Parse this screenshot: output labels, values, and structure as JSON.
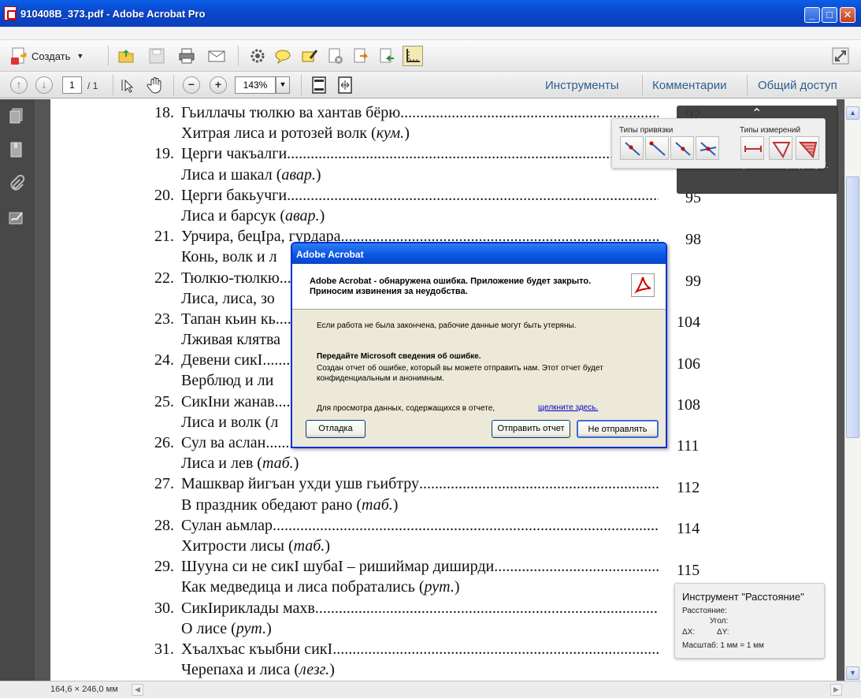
{
  "window": {
    "title": "910408B_373.pdf - Adobe Acrobat Pro",
    "minimize": "_",
    "maximize": "□",
    "close": "✕"
  },
  "toolbar": {
    "create_label": "Создать",
    "icons": [
      "open-folder-icon",
      "save-icon",
      "print-icon",
      "email-icon",
      "settings-icon",
      "comment-icon",
      "highlight-icon",
      "delete-page-icon",
      "export-icon",
      "import-icon",
      "measure-ruler-icon",
      "fullscreen-icon"
    ]
  },
  "nav": {
    "page_current": "1",
    "page_total": "/ 1",
    "zoom": "143%",
    "tabs": [
      "Инструменты",
      "Комментарии",
      "Общий доступ"
    ]
  },
  "toc": {
    "items": [
      {
        "num": "18.",
        "title": "Гьиллачы тюлкю ва хантав бёрю",
        "sub": "Хитрая лиса и ротозей волк (кум.)",
        "page": "92"
      },
      {
        "num": "19.",
        "title": "Церги чакъалги",
        "sub": "Лиса и шакал (авар.)",
        "page": ""
      },
      {
        "num": "20.",
        "title": "Церги бакьучги",
        "sub": "Лиса и барсук (авар.)",
        "page": "95"
      },
      {
        "num": "21.",
        "title": "Урчира, бецIра, гурдара",
        "sub": "Конь, волк и л",
        "page": "98"
      },
      {
        "num": "22.",
        "title": "Тюлкю-тюлкю",
        "sub": "Лиса, лиса, зо",
        "page": "99"
      },
      {
        "num": "23.",
        "title": "Тапан кьин кь",
        "sub": "Лживая клятва",
        "page": "104"
      },
      {
        "num": "24.",
        "title": "Девени сикI",
        "sub": "Верблюд и ли",
        "page": "106"
      },
      {
        "num": "25.",
        "title": "СикIни жанав",
        "sub": "Лиса и волк (л",
        "page": "108"
      },
      {
        "num": "26.",
        "title": "Сул ва аслан",
        "sub": "Лиса и лев (таб.)",
        "page": "111"
      },
      {
        "num": "27.",
        "title": "Машквар йигъан ухди ушв гьибтру",
        "sub": "В праздник обедают рано (таб.)",
        "page": "112"
      },
      {
        "num": "28.",
        "title": "Сулан аьмлар",
        "sub": "Хитрости лисы (таб.)",
        "page": "114"
      },
      {
        "num": "29.",
        "title": "Шууна си не сикI шубаI – ришиймар диширди",
        "sub": "Как медведица и лиса побратались (рут.)",
        "page": "115"
      },
      {
        "num": "30.",
        "title": "СикIириклады махв",
        "sub": "О лисе (рут.)",
        "page": ""
      },
      {
        "num": "31.",
        "title": "Хъалхъас къыбни сикI",
        "sub": "Черепаха и лиса (лезг.)",
        "page": ""
      }
    ]
  },
  "measure": {
    "snap_label": "Типы привязки",
    "measure_label": "Типы измерений",
    "tooltip_text": "Комментарии\" и \"Общий доступ\"."
  },
  "distance_tool": {
    "title": "Инструмент \"Расстояние\"",
    "distance": "Расстояние:",
    "angle": "Угол:",
    "dx": "ΔX:",
    "dy": "ΔY:",
    "scale": "Масштаб:  1 мм = 1 мм"
  },
  "status": {
    "dimensions": "164,6 × 246,0 мм"
  },
  "dialog": {
    "title": "Adobe Acrobat",
    "message": "Adobe Acrobat  - обнаружена ошибка. Приложение будет закрыто. Приносим извинения за неудобства.",
    "data_loss": "Если работа не была закончена, рабочие данные могут быть утеряны.",
    "send_heading": "Передайте Microsoft сведения об ошибке.",
    "send_text": "Создан отчет об ошибке, который вы можете отправить нам. Этот отчет будет конфиденциальным и анонимным.",
    "view_data": "Для просмотра данных, содержащихся в отчете,",
    "link": "щелкните здесь.",
    "debug_button": "Отладка",
    "send_button": "Отправить отчет",
    "dont_send_button": "Не отправлять"
  }
}
